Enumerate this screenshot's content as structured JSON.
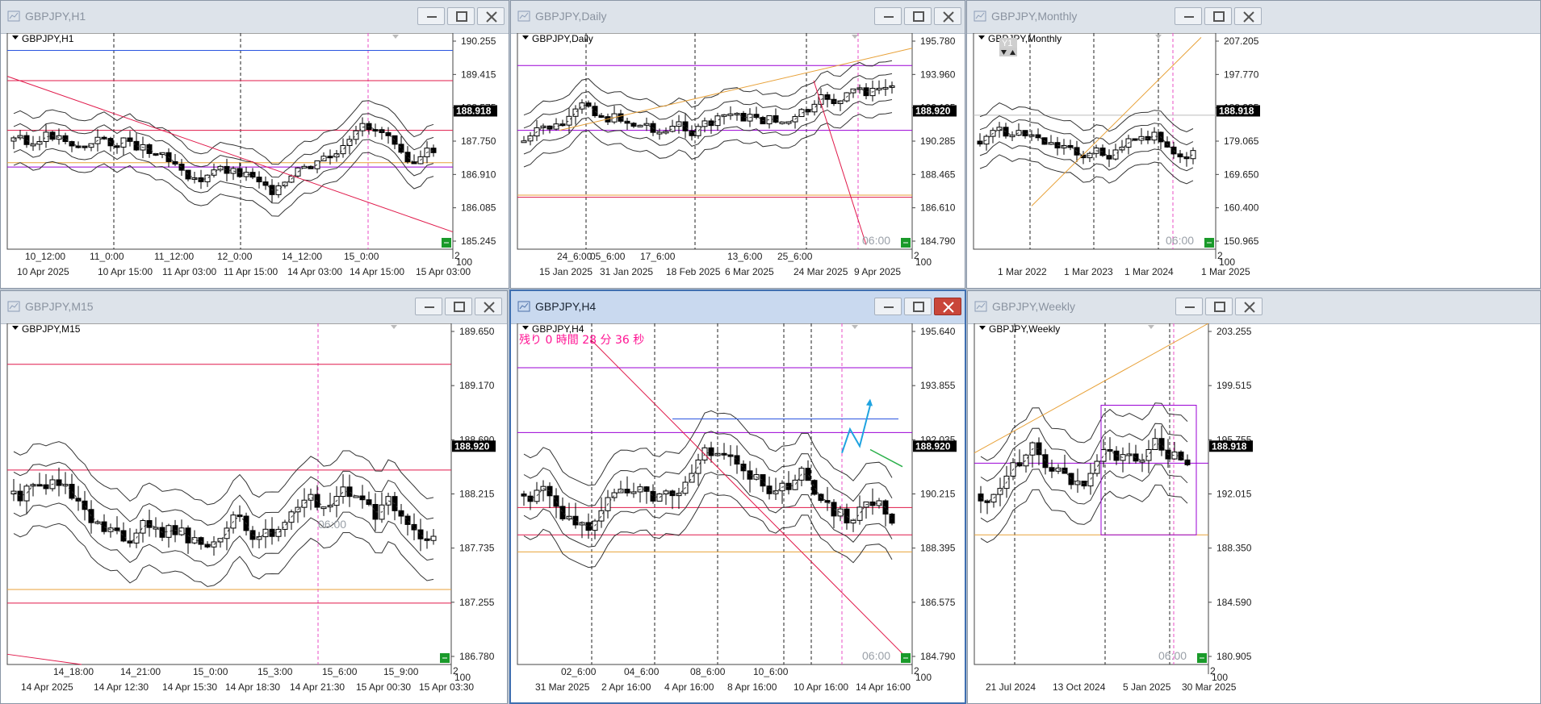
{
  "windows": [
    {
      "id": "w1",
      "title": "GBPJPY,H1",
      "symbol_label": "GBPJPY,H1",
      "active": false,
      "price_ticks": [
        "190.255",
        "189.415",
        "188.575",
        "187.750",
        "186.910",
        "186.085",
        "185.245"
      ],
      "current_price": "188.918",
      "time_ticks_top": [
        "10_12:00",
        "11_0:00",
        "11_12:00",
        "12_0:00",
        "14_12:00",
        "15_0:00"
      ],
      "time_ticks_bottom": [
        "10 Apr 2025",
        "10 Apr 15:00",
        "11 Apr 03:00",
        "11 Apr 15:00",
        "14 Apr 03:00",
        "14 Apr 15:00",
        "15 Apr 03:00"
      ],
      "corner_labels": [
        "2",
        "100"
      ],
      "extra_text": ""
    },
    {
      "id": "w2",
      "title": "GBPJPY,Daily",
      "symbol_label": "GBPJPY,Daily",
      "active": false,
      "price_ticks": [
        "195.780",
        "193.960",
        "192.105",
        "190.285",
        "188.465",
        "186.610",
        "184.790"
      ],
      "current_price": "188.920",
      "time_ticks_top": [
        "24_6:00",
        "05_6:00",
        "17_6:00",
        "13_6:00",
        "25_6:00"
      ],
      "time_ticks_bottom": [
        "15 Jan 2025",
        "31 Jan 2025",
        "18 Feb 2025",
        "6 Mar 2025",
        "24 Mar 2025",
        "9 Apr 2025"
      ],
      "corner_labels": [
        "2",
        "100"
      ],
      "extra_text": "06:00"
    },
    {
      "id": "w3",
      "title": "GBPJPY,Monthly",
      "symbol_label": "GBPJPY,Monthly",
      "active": false,
      "price_ticks": [
        "207.205",
        "197.770",
        "188.335",
        "179.065",
        "169.650",
        "160.400",
        "150.965"
      ],
      "current_price": "188.918",
      "time_ticks_top": [],
      "time_ticks_bottom": [
        "1 Mar 2022",
        "1 Mar 2023",
        "1 Mar 2024",
        "1 Mar 2025"
      ],
      "corner_labels": [
        "2",
        "100"
      ],
      "extra_text": "06:00",
      "badge": "Y1"
    },
    {
      "id": "w4",
      "title": "GBPJPY,M15",
      "symbol_label": "GBPJPY,M15",
      "active": false,
      "price_ticks": [
        "189.650",
        "189.170",
        "188.690",
        "188.215",
        "187.735",
        "187.255",
        "186.780"
      ],
      "current_price": "188.920",
      "time_ticks_top": [
        "14_18:00",
        "14_21:00",
        "15_0:00",
        "15_3:00",
        "15_6:00",
        "15_9:00"
      ],
      "time_ticks_bottom": [
        "14 Apr 2025",
        "14 Apr 12:30",
        "14 Apr 15:30",
        "14 Apr 18:30",
        "14 Apr 21:30",
        "15 Apr 00:30",
        "15 Apr 03:30"
      ],
      "corner_labels": [
        "2",
        "100"
      ],
      "extra_text": "06:00"
    },
    {
      "id": "w5",
      "title": "GBPJPY,H4",
      "symbol_label": "GBPJPY,H4",
      "active": true,
      "price_ticks": [
        "195.640",
        "193.855",
        "192.035",
        "190.215",
        "188.395",
        "186.575",
        "184.790"
      ],
      "current_price": "188.920",
      "time_ticks_top": [
        "02_6:00",
        "04_6:00",
        "08_6:00",
        "10_6:00"
      ],
      "time_ticks_bottom": [
        "31 Mar 2025",
        "2 Apr 16:00",
        "4 Apr 16:00",
        "8 Apr 16:00",
        "10 Apr 16:00",
        "14 Apr 16:00"
      ],
      "corner_labels": [
        "2",
        "100"
      ],
      "extra_text": "06:00",
      "countdown": "残り 0 時間 28 分 36 秒"
    },
    {
      "id": "w6",
      "title": "GBPJPY,Weekly",
      "symbol_label": "GBPJPY,Weekly",
      "active": false,
      "price_ticks": [
        "203.255",
        "199.515",
        "195.755",
        "192.015",
        "188.350",
        "184.590",
        "180.905"
      ],
      "current_price": "188.918",
      "time_ticks_top": [],
      "time_ticks_bottom": [
        "21 Jul 2024",
        "13 Oct 2024",
        "5 Jan 2025",
        "30 Mar 2025"
      ],
      "corner_labels": [
        "2",
        "100"
      ],
      "extra_text": "06:00"
    }
  ],
  "colors": {
    "bull": "#ffffff",
    "bear": "#000000",
    "red_line": "#e0194a",
    "purple_line": "#9b00d6",
    "blue_line": "#2a55e0",
    "orange_line": "#e8a23a",
    "magenta_vline": "#e84cc4",
    "price_tag_bg": "#000000",
    "green_box": "#1a9a2a",
    "countdown": "#ff1493",
    "arrow_blue": "#1fa3e0",
    "arrow_green": "#2bb04a"
  }
}
